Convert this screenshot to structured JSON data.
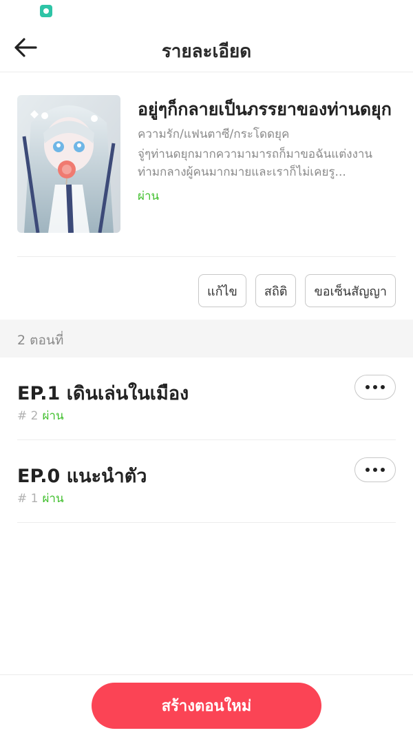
{
  "header": {
    "title": "รายละเอียด"
  },
  "novel": {
    "title": "อยู่ๆก็กลายเป็นภรรยาของท่านดยุก",
    "genres": "ความรัก/แฟนตาซี/กระโดดยุค",
    "synopsis": "จู่ๆท่านดยุกมากความามารถก็มาขอฉันแต่งงานท่ามกลางผู้คนมากมายและเราก็ไม่เคยรู...",
    "status": "ผ่าน"
  },
  "actions": {
    "edit_label": "แก้ไข",
    "stats_label": "สถิติ",
    "contract_label": "ขอเซ็นสัญญา"
  },
  "episodes": {
    "count_label": "2 ตอนที่",
    "items": [
      {
        "title": "EP.1 เดินเล่นในเมือง",
        "number": "# 2",
        "status": "ผ่าน"
      },
      {
        "title": "EP.0 แนะนำตัว",
        "number": "# 1",
        "status": "ผ่าน"
      }
    ]
  },
  "bottom": {
    "create_label": "สร้างตอนใหม่"
  },
  "colors": {
    "accent": "#fb4455",
    "pass": "#3fbf2c",
    "status_icon": "#2ec4a6"
  },
  "icons": {
    "back": "arrow-left-icon",
    "more": "more-dots-icon",
    "status_app": "chat-app-icon"
  }
}
